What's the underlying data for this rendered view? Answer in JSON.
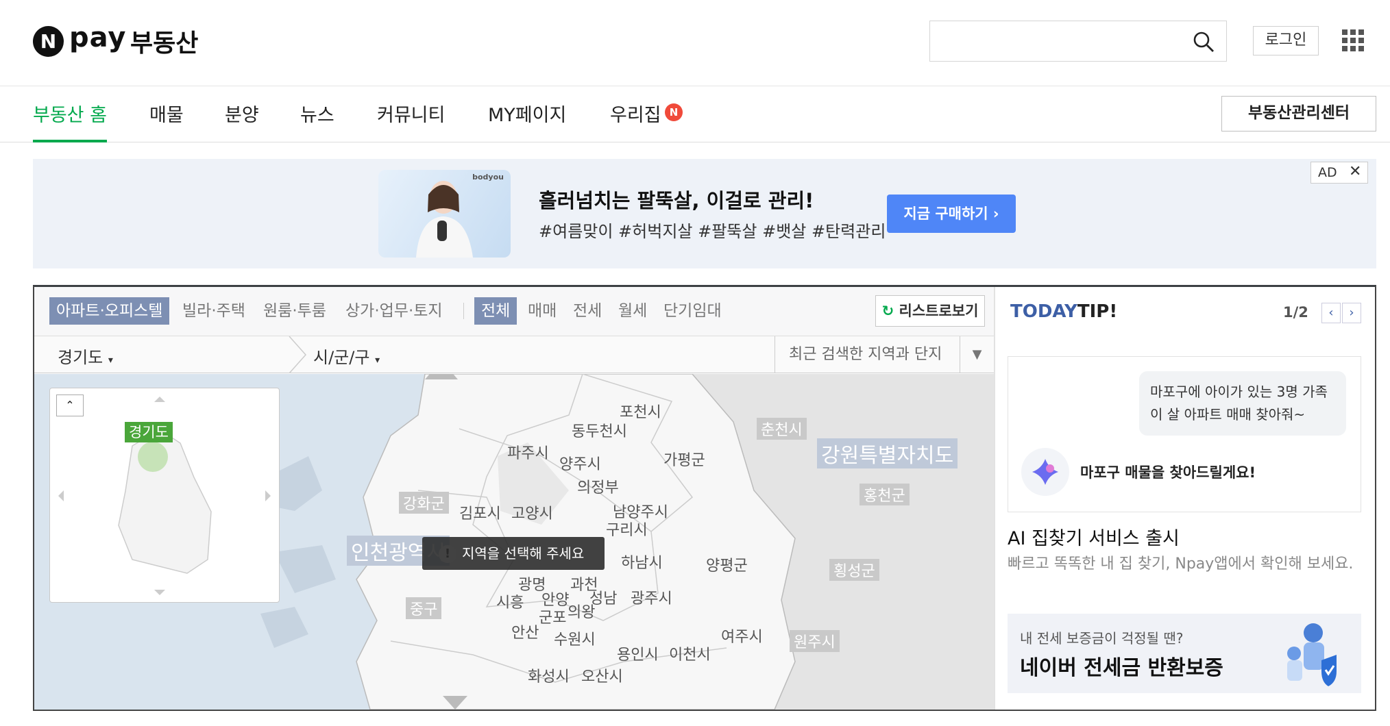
{
  "header": {
    "logo_n": "N",
    "logo_pay": "pay",
    "logo_title": "부동산",
    "search_placeholder": "",
    "login_label": "로그인"
  },
  "nav": {
    "items": [
      "부동산 홈",
      "매물",
      "분양",
      "뉴스",
      "커뮤니티",
      "MY페이지",
      "우리집"
    ],
    "active": "부동산 홈",
    "badge": "N",
    "mgmt_label": "부동산관리센터"
  },
  "ad": {
    "brand": "bodyou",
    "title": "흘러넘치는 팔뚝살, 이걸로 관리!",
    "desc": "#여름맞이 #허벅지살 #팔뚝살 #뱃살 #탄력관리",
    "button": "지금 구매하기 ›",
    "tag": "AD",
    "close": "✕"
  },
  "filters": {
    "property_types": [
      "아파트·오피스텔",
      "빌라·주택",
      "원룸·투룸",
      "상가·업무·토지"
    ],
    "deal_types": [
      "전체",
      "매매",
      "전세",
      "월세",
      "단기임대"
    ],
    "list_button": "리스트로보기"
  },
  "region": {
    "province": "경기도",
    "city": "시/군/구",
    "recent": "최근 검색한 지역과 단지"
  },
  "map": {
    "mini_label": "경기도",
    "tooltip": "지역을 선택해 주세요",
    "labels": [
      "포천시",
      "동두천시",
      "파주시",
      "양주시",
      "가평군",
      "의정부",
      "춘천시",
      "강원특별자치도",
      "홍천군",
      "강화군",
      "김포시",
      "고양시",
      "남양주시",
      "구리시",
      "인천광역시",
      "하남시",
      "양평군",
      "횡성군",
      "광명",
      "과천",
      "시흥",
      "안양",
      "성남",
      "광주시",
      "군포",
      "의왕",
      "중구",
      "안산",
      "수원시",
      "여주시",
      "원주시",
      "용인시",
      "이천시",
      "화성시",
      "오산시"
    ]
  },
  "tip": {
    "title_today": "TODAY",
    "title_tip": "TIP!",
    "page": "1/2",
    "bubble": "마포구에 아이가 있는 3명 가족이 살 아파트 매매 찾아줘~",
    "ai_text": "마포구 매물을 찾아드릴게요!",
    "heading": "AI 집찾기 서비스 출시",
    "desc": "빠르고 똑똑한 내 집 찾기, Npay앱에서 확인해 보세요.",
    "banner_sub": "내 전세 보증금이 걱정될 땐?",
    "banner_main": "네이버 전세금 반환보증"
  },
  "colors": {
    "accent": "#03a94d",
    "ad_button": "#4f86f7",
    "tab_selected": "#7d8fb3",
    "tip_title": "#3d5fa6"
  }
}
